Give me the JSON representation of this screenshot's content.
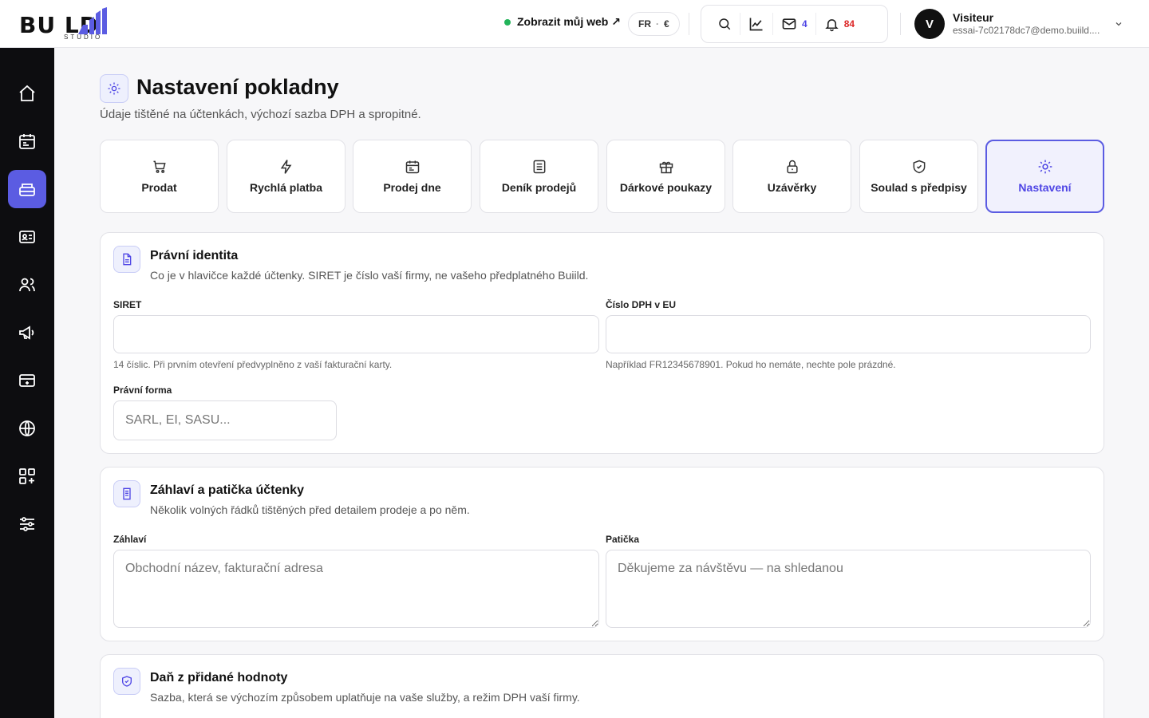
{
  "brand": {
    "name": "BU  LD",
    "sub": "STUDIO"
  },
  "header": {
    "site_link": "Zobrazit můj web ↗",
    "lang": "FR",
    "currency": "€",
    "mail_count": "4",
    "notif_count": "84",
    "user_initial": "V",
    "user_name": "Visiteur",
    "user_email": "essai-7c02178dc7@demo.buiild...."
  },
  "colors": {
    "accent": "#5b5ce2",
    "online": "#22b45a",
    "notif": "#dc2626",
    "mail": "#4f46e5"
  },
  "page": {
    "title": "Nastavení pokladny",
    "subtitle": "Údaje tištěné na účtenkách, výchozí sazba DPH a spropitné."
  },
  "tabs": [
    {
      "label": "Prodat",
      "icon": "cart-icon"
    },
    {
      "label": "Rychlá platba",
      "icon": "bolt-icon"
    },
    {
      "label": "Prodej dne",
      "icon": "calendar-icon"
    },
    {
      "label": "Deník prodejů",
      "icon": "list-icon"
    },
    {
      "label": "Dárkové poukazy",
      "icon": "gift-icon"
    },
    {
      "label": "Uzávěrky",
      "icon": "lock-icon"
    },
    {
      "label": "Soulad s předpisy",
      "icon": "shield-icon"
    },
    {
      "label": "Nastavení",
      "icon": "sun-gear-icon",
      "active": true
    }
  ],
  "legal": {
    "title": "Právní identita",
    "subtitle": "Co je v hlavičce každé účtenky. SIRET je číslo vaší firmy, ne vašeho předplatného Buiild.",
    "siret_label": "SIRET",
    "siret_value": "",
    "siret_hint": "14 číslic. Při prvním otevření předvyplněno z vaší fakturační karty.",
    "vat_label": "Číslo DPH v EU",
    "vat_value": "",
    "vat_hint": "Například FR12345678901. Pokud ho nemáte, nechte pole prázdné.",
    "form_label": "Právní forma",
    "form_placeholder": "SARL, EI, SASU..."
  },
  "receipt": {
    "title": "Záhlaví a patička účtenky",
    "subtitle": "Několik volných řádků tištěných před detailem prodeje a po něm.",
    "header_label": "Záhlaví",
    "header_placeholder": "Obchodní název, fakturační adresa",
    "footer_label": "Patička",
    "footer_placeholder": "Děkujeme za návštěvu — na shledanou"
  },
  "vat": {
    "title": "Daň z přidané hodnoty",
    "subtitle": "Sazba, která se výchozím způsobem uplatňuje na vaše služby, a režim DPH vaší firmy."
  }
}
